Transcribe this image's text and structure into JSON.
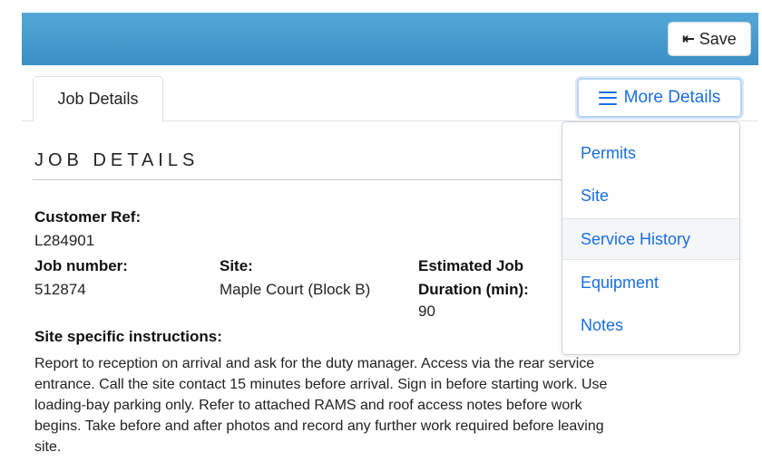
{
  "toolbar": {
    "save_label": "Save",
    "save_icon": "⇤"
  },
  "tabs": [
    {
      "label": "Job Details"
    }
  ],
  "more_details": {
    "label": "More Details",
    "items": [
      {
        "label": "Permits"
      },
      {
        "label": "Site"
      },
      {
        "label": "Service History",
        "active": true
      },
      {
        "label": "Equipment"
      },
      {
        "label": "Notes"
      }
    ]
  },
  "section": {
    "title": "JOB DETAILS",
    "customer_ref": {
      "label": "Customer Ref:",
      "value": "L284901"
    },
    "job_number": {
      "label": "Job number:",
      "value": "512874"
    },
    "site": {
      "label": "Site:",
      "value": "Maple Court (Block B)"
    },
    "duration": {
      "label_line1": "Estimated Job",
      "label_line2": "Duration (min):",
      "value": "90"
    },
    "instructions": {
      "label": "Site specific instructions:",
      "text": "Report to reception on arrival and ask for the duty manager. Access via the rear service entrance. Call the site contact 15 minutes before arrival. Sign in before starting work. Use loading-bay parking only. Refer to attached RAMS and roof access notes before work begins. Take before and after photos and record any further work required before leaving site."
    }
  },
  "colors": {
    "topbar": "#3b8fc4",
    "link": "#1a6fe0"
  }
}
